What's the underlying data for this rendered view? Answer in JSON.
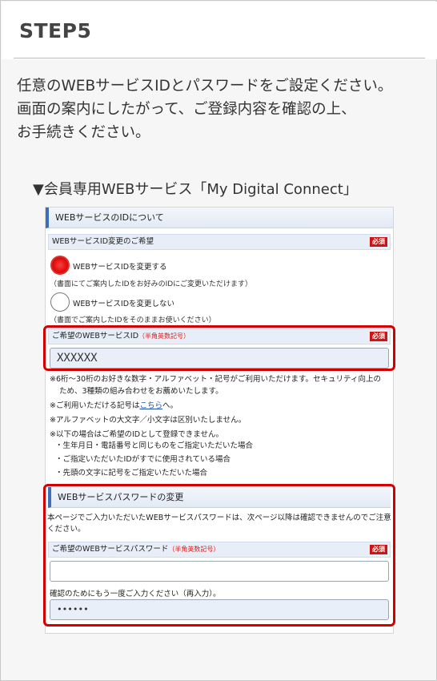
{
  "step": {
    "title": "STEP5"
  },
  "intro": {
    "lines": [
      "任意のWEBサービスIDとパスワードをご設定ください。",
      "画面の案内にしたがって、ご登録内容を確認の上、",
      "お手続きください。"
    ]
  },
  "caption": "▼会員専用WEBサービス「My Digital Connect」",
  "panel": {
    "id_section_title": "WEBサービスのIDについて",
    "change_pref": {
      "label": "WEBサービスID変更のご希望",
      "required": "必須"
    },
    "options": [
      {
        "label": "WEBサービスIDを変更する",
        "note": "（書面にてご案内したIDをお好みのIDにご変更いただけます）",
        "checked": true
      },
      {
        "label": "WEBサービスIDを変更しない",
        "note": "（書面でご案内したIDをそのままお使いください）",
        "checked": false
      }
    ],
    "desired_id": {
      "label": "ご希望のWEBサービスID",
      "hint": "（半角英数記号）",
      "required": "必須",
      "value": "XXXXXX"
    },
    "notes": [
      "※6桁～30桁のお好きな数字・アルファベット・記号がご利用いただけます。セキュリティ向上の",
      "ため、3種類の組み合わせをお薦めいたします。",
      "※ご利用いただける記号は",
      "こちら",
      "へ。",
      "※アルファベットの大文字／小文字は区別いたしません。",
      "※以下の場合はご希望のIDとして登録できません。"
    ],
    "bullets": [
      "生年月日・電話番号と同じものをご指定いただいた場合",
      "ご指定いただいたIDがすでに使用されている場合",
      "先頭の文字に記号をご指定いただいた場合"
    ],
    "pw_section_title": "WEBサービスパスワードの変更",
    "pw_desc": "本ページでご入力いただいたWEBサービスパスワードは、次ページ以降は確認できませんのでご注意ください。",
    "desired_pw": {
      "label": "ご希望のWEBサービスパスワード",
      "hint": "（半角英数記号）",
      "required": "必須",
      "value": ""
    },
    "confirm": {
      "label": "確認のためにもう一度ご入力ください（再入力）。",
      "value": "••••••"
    }
  }
}
